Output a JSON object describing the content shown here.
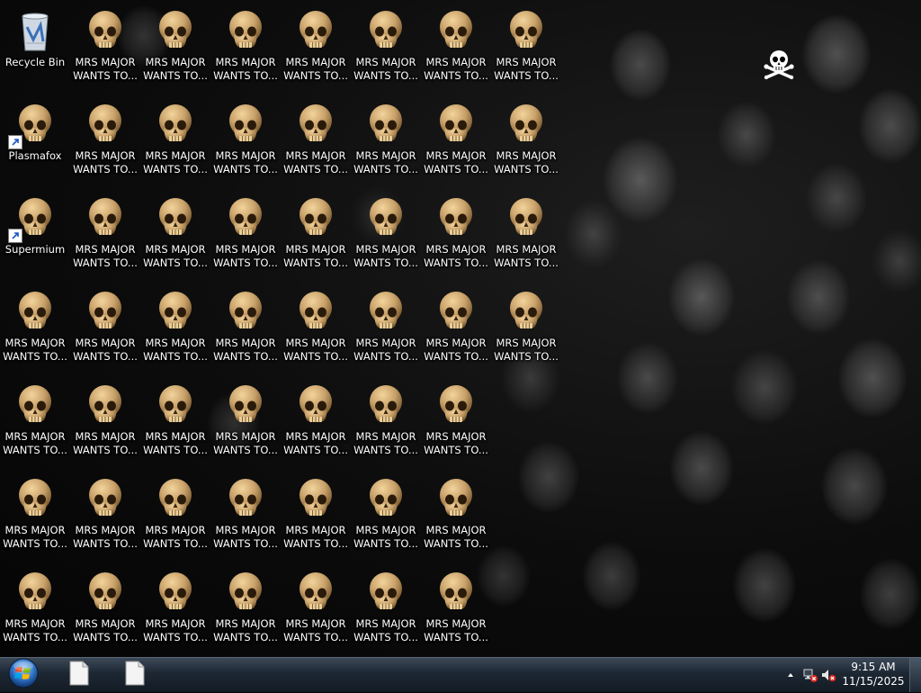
{
  "desktop": {
    "recycle_bin": {
      "label": "Recycle Bin",
      "icon": "recycle-bin-icon"
    },
    "plasmafox": {
      "label": "Plasmafox",
      "icon": "skull-icon",
      "shortcut": true
    },
    "supermium": {
      "label": "Supermium",
      "icon": "skull-icon",
      "shortcut": true
    },
    "file_label": "MRS MAJOR\nWANTS TO...",
    "file_icon": "skull-icon",
    "file_icon_count": 50,
    "corner_icon": "skull-crossbones-icon"
  },
  "taskbar": {
    "start_icon": "windows-orb-icon",
    "buttons": [
      {
        "icon": "blank-document-icon"
      },
      {
        "icon": "blank-document-icon"
      }
    ],
    "tray": {
      "show_hidden_icon": "up-arrow-icon",
      "network_icon": "network-error-icon",
      "volume_icon": "volume-muted-icon",
      "time": "9:15 AM",
      "date": "11/15/2025"
    }
  },
  "colors": {
    "skull": "#c9a26a",
    "taskbar": "#1d2733",
    "label_text": "#ffffff"
  }
}
